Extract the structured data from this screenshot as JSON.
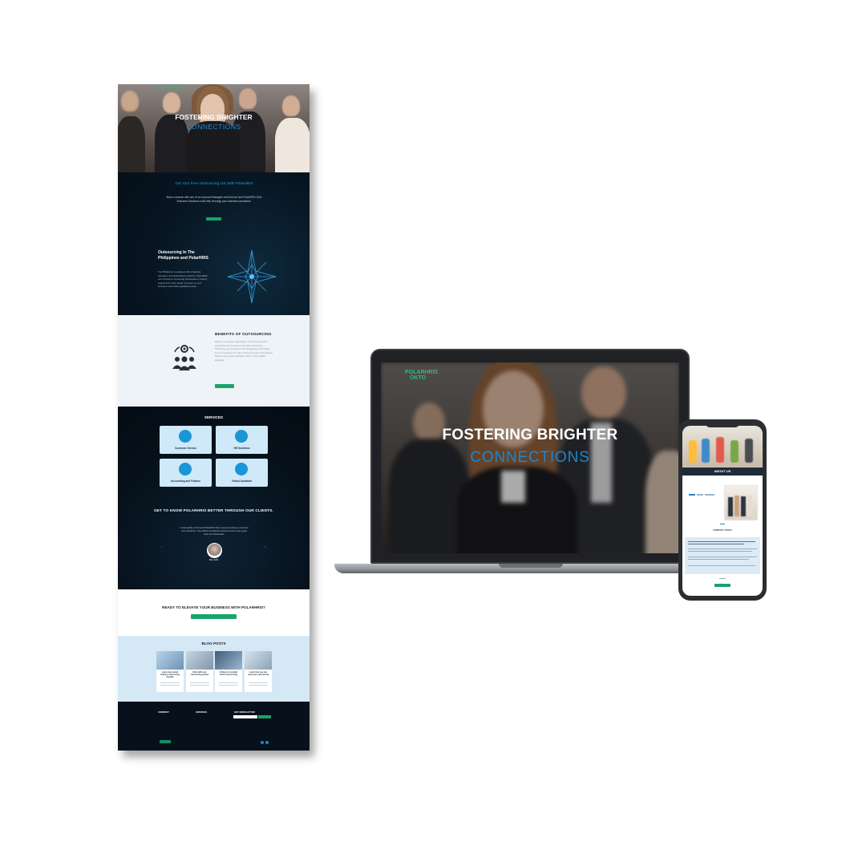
{
  "long_page": {
    "logo": "POLARHRIS OKTO",
    "hero": {
      "title": "FOSTERING BRIGHTER",
      "subtitle": "CONNECTIONS"
    },
    "free_consult": {
      "title": "Get Your Free Outsourcing 101 With PolarHRIS",
      "body": "Book a session with one of our Account Managers and find out how PolarHRIS-Okto Business Solutions could help leverage your business operations."
    },
    "outsourcing": {
      "title": "Outsourcing In The Philippines and PolarHRIS",
      "body": "The Philippines is equipped with a talented, educated, and hardworking workforce. PolarHRIS' core function is connecting businesses to industry experts fit for their needs. Cut down on your business costs while upgrading results."
    },
    "benefits": {
      "title": "BENEFITS OF OUTSOURCING",
      "body": "Reduce overheads, expenditure, business, get better productivity and increase profit with outsourcing. Offshoring your business in the Philippines is beneficial for your business as it has a history and one of the largest Filipino talent pools worldwide, fluent in the English language."
    },
    "services": {
      "title": "SERVICES",
      "items": [
        "Customer Service",
        "HR Solutions",
        "Accounting and Finance",
        "Virtual Assistant"
      ]
    },
    "clients": {
      "title": "GET TO KNOW POLARHRIS BETTER THROUGH OUR CLIENTS.",
      "quote": "I would gladly recommend PolarHRIS Okto to anyone looking to outsource their operations. They deliver exceptional customer service and a great team of professionals.",
      "name": "Ben Judd"
    },
    "cta": {
      "title": "READY TO ELEVATE YOUR BUSINESS WITH POLARHRIS?"
    },
    "blog": {
      "title": "BLOG POSTS",
      "posts": [
        "Learn more about industry outsourcing benefits",
        "Work with your outsourcing partner",
        "4 things to consider before outsourcing",
        "Learn how you can scale your outsourcing"
      ]
    },
    "footer": {
      "col1": "COMPANY",
      "col2": "SERVICES",
      "col3": "GET NEWSLETTER",
      "subscribe": "SUBSCRIBE"
    }
  },
  "laptop": {
    "logo_line1": "POLARHRIS",
    "logo_line2": "OKTO",
    "title": "FOSTERING BRIGHTER",
    "subtitle": "CONNECTIONS"
  },
  "phone": {
    "section_title": "ABOUT US",
    "company_story": "COMPANY STORY"
  },
  "colors": {
    "accent_blue": "#1b86d3",
    "brand_green": "#1ec27c",
    "dark_navy": "#07111b"
  }
}
